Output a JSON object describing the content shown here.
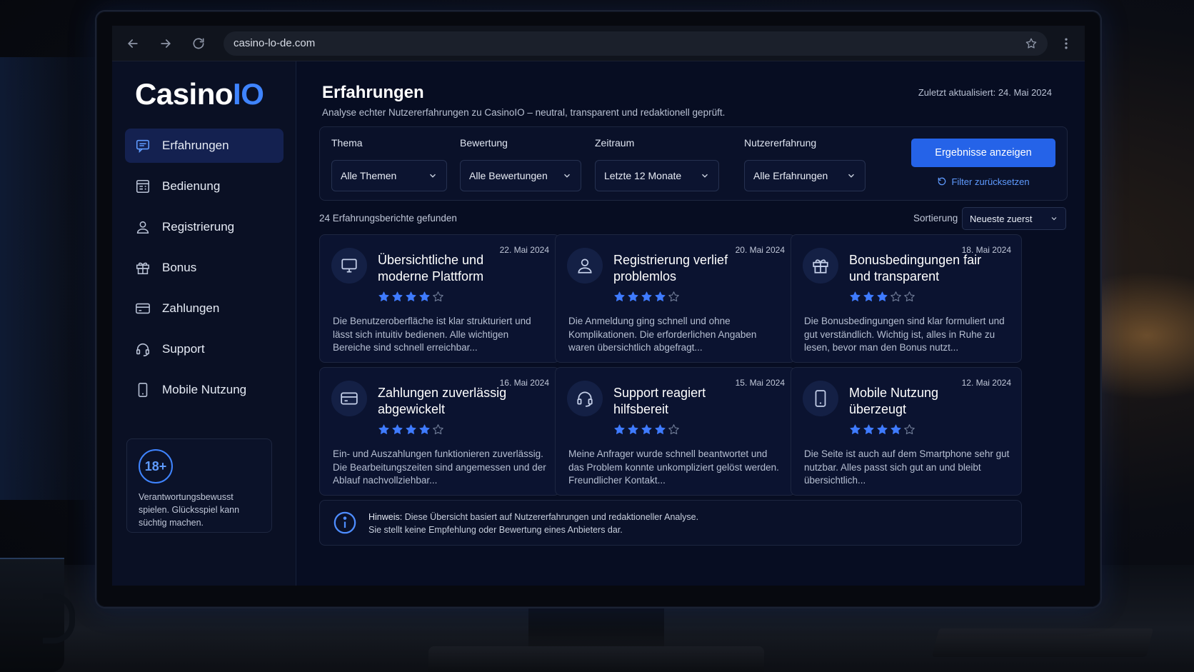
{
  "browser": {
    "url": "casino-lo-de.com"
  },
  "sidebar": {
    "logo_main": "Casino",
    "logo_accent": "IO",
    "items": [
      {
        "label": "Erfahrungen",
        "icon": "chat-icon",
        "active": true
      },
      {
        "label": "Bedienung",
        "icon": "layout-icon",
        "active": false
      },
      {
        "label": "Registrierung",
        "icon": "user-icon",
        "active": false
      },
      {
        "label": "Bonus",
        "icon": "gift-icon",
        "active": false
      },
      {
        "label": "Zahlungen",
        "icon": "credit-card-icon",
        "active": false
      },
      {
        "label": "Support",
        "icon": "headset-icon",
        "active": false
      },
      {
        "label": "Mobile Nutzung",
        "icon": "smartphone-icon",
        "active": false
      }
    ],
    "age_badge": "18+",
    "age_text": "Verantwortungsbewusst spielen. Glücksspiel kann süchtig machen."
  },
  "header": {
    "title": "Erfahrungen",
    "subtitle": "Analyse echter Nutzererfahrungen zu CasinoIO – neutral, transparent und redaktionell geprüft.",
    "updated": "Zuletzt aktualisiert: 24. Mai 2024"
  },
  "filters": {
    "groups": [
      {
        "label": "Thema",
        "value": "Alle Themen"
      },
      {
        "label": "Bewertung",
        "value": "Alle Bewertungen"
      },
      {
        "label": "Zeitraum",
        "value": "Letzte 12 Monate"
      },
      {
        "label": "Nutzererfahrung",
        "value": "Alle Erfahrungen"
      }
    ],
    "apply_label": "Ergebnisse anzeigen",
    "reset_label": "Filter zurücksetzen"
  },
  "results": {
    "count_text": "24 Erfahrungsberichte gefunden",
    "sort_label": "Sortierung",
    "sort_value": "Neueste zuerst"
  },
  "cards": [
    {
      "icon": "monitor-icon",
      "date": "22. Mai 2024",
      "title": "Übersichtliche und moderne Plattform",
      "rating": 4,
      "text": "Die Benutzeroberfläche ist klar strukturiert und lässt sich intuitiv bedienen. Alle wichtigen Bereiche sind schnell erreichbar..."
    },
    {
      "icon": "user-icon",
      "date": "20. Mai 2024",
      "title": "Registrierung verlief problemlos",
      "rating": 4,
      "text": "Die Anmeldung ging schnell und ohne Komplikationen. Die erforderlichen Angaben waren übersichtlich abgefragt..."
    },
    {
      "icon": "gift-icon",
      "date": "18. Mai 2024",
      "title": "Bonusbedingungen fair und transparent",
      "rating": 3,
      "text": "Die Bonusbedingungen sind klar formuliert und gut verständlich. Wichtig ist, alles in Ruhe zu lesen, bevor man den Bonus nutzt..."
    },
    {
      "icon": "credit-card-icon",
      "date": "16. Mai 2024",
      "title": "Zahlungen zuverlässig abgewickelt",
      "rating": 4,
      "text": "Ein- und Auszahlungen funktionieren zuverlässig. Die Bearbeitungszeiten sind angemessen und der Ablauf nachvollziehbar..."
    },
    {
      "icon": "headset-icon",
      "date": "15. Mai 2024",
      "title": "Support reagiert hilfsbereit",
      "rating": 4,
      "text": "Meine Anfrager wurde schnell beantwortet und das Problem konnte unkompliziert gelöst werden. Freundlicher Kontakt..."
    },
    {
      "icon": "smartphone-icon",
      "date": "12. Mai 2024",
      "title": "Mobile Nutzung überzeugt",
      "rating": 4,
      "text": "Die Seite ist auch auf dem Smartphone sehr gut nutzbar. Alles passt sich gut an und bleibt übersichtlich..."
    }
  ],
  "note": {
    "label": "Hinweis:",
    "line1": "Diese Übersicht basiert auf Nutzererfahrungen und redaktioneller Analyse.",
    "line2": "Sie stellt keine Empfehlung oder Bewertung eines Anbieters dar."
  },
  "colors": {
    "accent": "#3f84ff",
    "button": "#2563e8",
    "star_filled": "#3f7bff",
    "star_empty": "#6f7b96",
    "background": "#070d22"
  }
}
